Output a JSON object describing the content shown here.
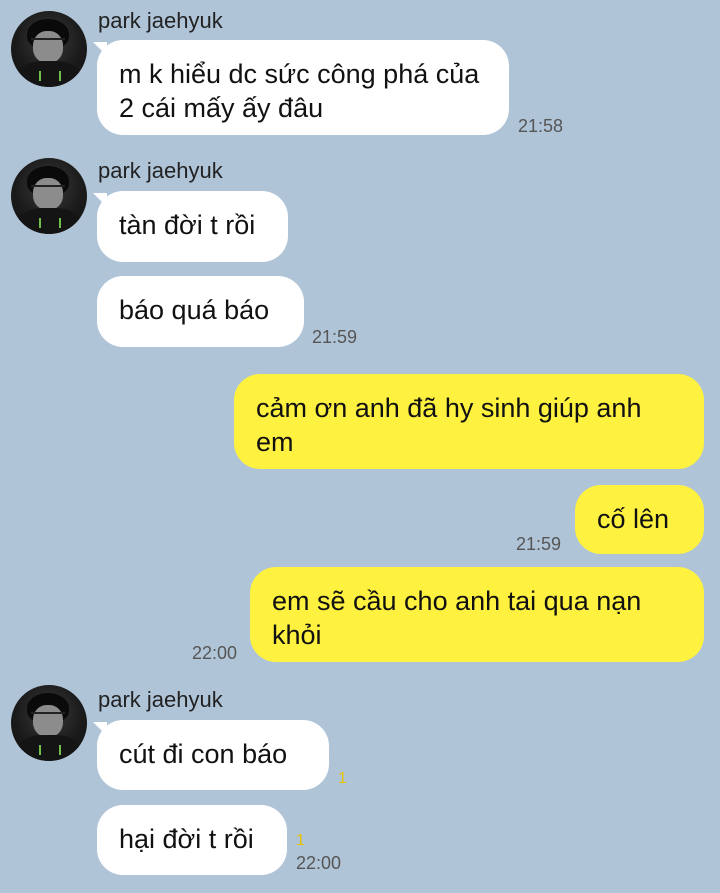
{
  "messages": {
    "group1": {
      "sender": "park jaehyuk",
      "bubble1": "m k hiểu dc sức công phá của 2 cái mấy ấy đâu",
      "time": "21:58"
    },
    "group2": {
      "sender": "park jaehyuk",
      "bubble1": "tàn đời t rồi",
      "bubble2": "báo quá báo",
      "time": "21:59"
    },
    "out1": {
      "text": "cảm ơn anh đã hy sinh giúp anh em"
    },
    "out2": {
      "text": "cố lên",
      "time": "21:59"
    },
    "out3": {
      "text": "em sẽ cầu cho anh tai qua nạn khỏi",
      "time": "22:00"
    },
    "group3": {
      "sender": "park jaehyuk",
      "bubble1": "cút đi con báo",
      "bubble1_unread": "1",
      "bubble2": "hại đời t rồi",
      "bubble2_unread": "1",
      "time": "22:00"
    }
  },
  "colors": {
    "background": "#b0c4d8",
    "incoming_bubble": "#ffffff",
    "outgoing_bubble": "#fef140",
    "unread_count": "#e5c100"
  }
}
